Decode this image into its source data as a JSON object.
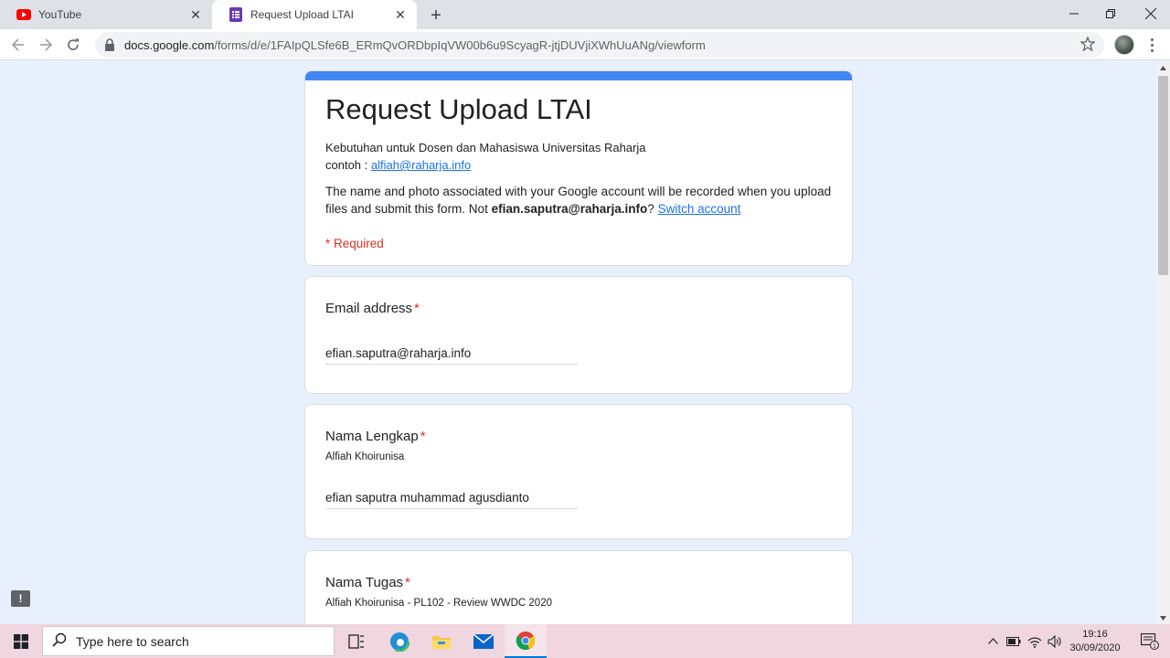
{
  "browser": {
    "tabs": [
      {
        "title": "YouTube",
        "icon": "youtube-icon",
        "active": false
      },
      {
        "title": "Request Upload LTAI",
        "icon": "google-forms-icon",
        "active": true
      }
    ],
    "url_host": "docs.google.com",
    "url_path": "/forms/d/e/1FAIpQLSfe6B_ERmQvORDbpIqVW00b6u9ScyagR-jtjDUVjiXWhUuANg/viewform"
  },
  "form": {
    "title": "Request Upload LTAI",
    "description_line1": "Kebutuhan untuk Dosen dan Mahasiswa Universitas Raharja",
    "description_example_prefix": "contoh : ",
    "description_example_link": "alfiah@raharja.info",
    "account_note_pre": "The name and photo associated with your Google account will be recorded when you upload files and submit this form. Not ",
    "account_email": "efian.saputra@raharja.info",
    "account_note_post": "? ",
    "switch_account": "Switch account",
    "required_note": "* Required",
    "questions": [
      {
        "label": "Email address",
        "required_mark": "*",
        "description": "",
        "value": "efian.saputra@raharja.info"
      },
      {
        "label": "Nama Lengkap",
        "required_mark": "*",
        "description": "Alfiah Khoirunisa",
        "value": "efian saputra muhammad agusdianto"
      },
      {
        "label": "Nama Tugas",
        "required_mark": "*",
        "description": "Alfiah Khoirunisa - PL102 - Review WWDC 2020",
        "value": ""
      }
    ]
  },
  "taskbar": {
    "search_placeholder": "Type here to search",
    "time": "19:16",
    "date": "30/09/2020"
  },
  "colors": {
    "form_accent": "#4285f4",
    "page_background": "#e8f0fe",
    "required_red": "#d93025",
    "link_blue": "#1a73e8",
    "taskbar": "#f0d6df"
  }
}
